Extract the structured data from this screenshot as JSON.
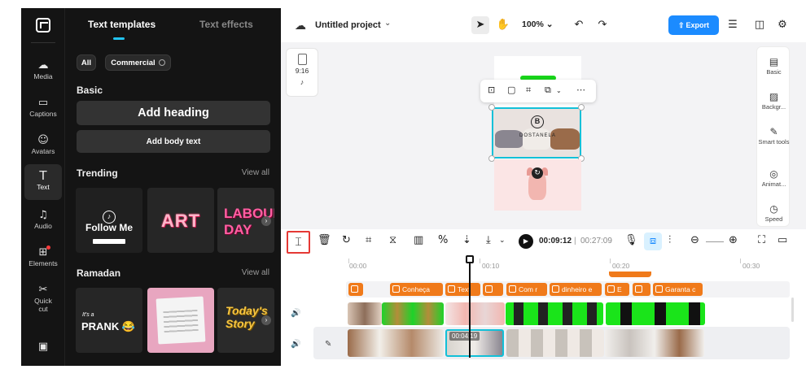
{
  "rail": {
    "items": [
      {
        "label": "Media",
        "icon": "cloud-upload-icon"
      },
      {
        "label": "Captions",
        "icon": "captions-icon"
      },
      {
        "label": "Avatars",
        "icon": "avatar-icon"
      },
      {
        "label": "Text",
        "icon": "text-icon"
      },
      {
        "label": "Audio",
        "icon": "music-icon"
      },
      {
        "label": "Elements",
        "icon": "elements-icon"
      },
      {
        "label": "Quick cut",
        "icon": "quick-cut-icon"
      }
    ]
  },
  "panel": {
    "tabs": [
      "Text templates",
      "Text effects"
    ],
    "filters": [
      "All",
      "Commercial"
    ],
    "basic_title": "Basic",
    "add_heading": "Add heading",
    "add_body": "Add body text",
    "trending_title": "Trending",
    "view_all": "View all",
    "trending_cards": [
      "Follow Me",
      "ART",
      "LABOUR DAY"
    ],
    "ramadan_title": "Ramadan",
    "ramadan_cards": [
      "It's a",
      "PRANK",
      "Today's Story"
    ]
  },
  "header": {
    "project_title": "Untitled project",
    "zoom": "100%",
    "export_label": "Export"
  },
  "stage": {
    "ratio": "9:16",
    "brand": "DOSTANELA"
  },
  "right_rail": {
    "items": [
      "Basic",
      "Backgr...",
      "Smart tools",
      "Animat...",
      "Speed"
    ]
  },
  "timeline": {
    "current_time": "00:09:12",
    "total_time": "00:27:09",
    "ruler": [
      "00:00",
      "00:10",
      "00:20",
      "00:30"
    ],
    "text_clips": [
      "Conheça",
      "Text",
      "",
      "Com r",
      "dinheiro e",
      "E",
      "",
      "Garanta c"
    ],
    "bubble_time": "00:04:19"
  },
  "colors": {
    "accent": "#1b8bff",
    "text_clip": "#f07a1a",
    "selection": "#12c0d8",
    "highlight_box": "#e53935"
  }
}
